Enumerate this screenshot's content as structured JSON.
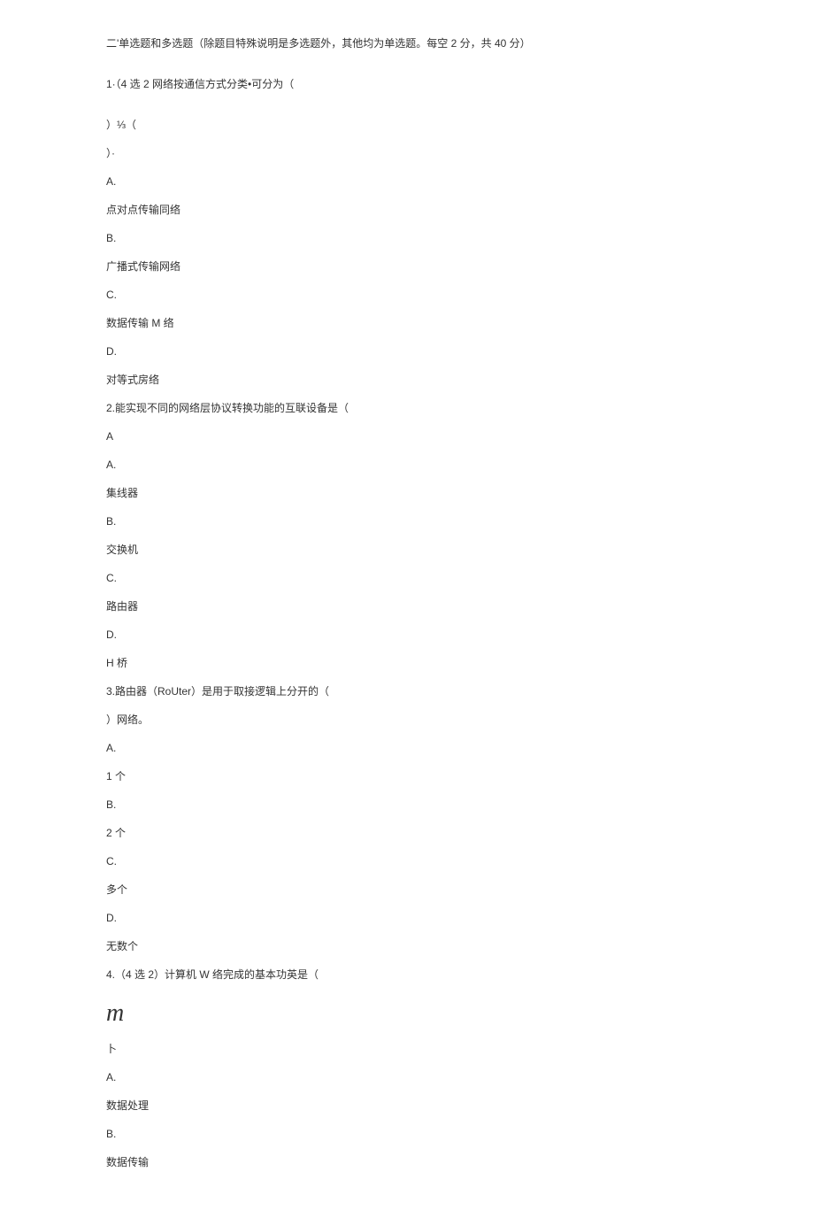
{
  "sectionTitle": "二'单选题和多选题（除题目特殊说明是多选题外，其他均为单选题。每空 2 分，共 40 分）",
  "q1": {
    "stem": "1·（4 选 2 网络按通信方式分类•可分为（",
    "extra1": "）⅓（",
    "extra2": "）·",
    "optA_label": "A.",
    "optA_text": "点对点传输同络",
    "optB_label": "B.",
    "optB_text": "广播式传输网络",
    "optC_label": "C.",
    "optC_text": "数据传输 M 络",
    "optD_label": "D.",
    "optD_text": "对等式房络"
  },
  "q2": {
    "stem": "2.能实现不同的网络层协议转换功能的互联设备是（",
    "extra1": "A",
    "optA_label": "A.",
    "optA_text": "集线器",
    "optB_label": "B.",
    "optB_text": "交换机",
    "optC_label": "C.",
    "optC_text": "路由器",
    "optD_label": "D.",
    "optD_text": "H 桥"
  },
  "q3": {
    "stem": "3.路由器（RoUter）是用于取接逻辑上分开的（",
    "extra1": "）网络。",
    "optA_label": "A.",
    "optA_text": "1 个",
    "optB_label": "B.",
    "optB_text": "2 个",
    "optC_label": "C.",
    "optC_text": "多个",
    "optD_label": "D.",
    "optD_text": "无数个"
  },
  "q4": {
    "stem": "4.（4 选 2）计算机 W 络完成的基本功英是（",
    "bigM": "m",
    "extra1": "卜",
    "optA_label": "A.",
    "optA_text": "数据处理",
    "optB_label": "B.",
    "optB_text": "数据传输"
  }
}
